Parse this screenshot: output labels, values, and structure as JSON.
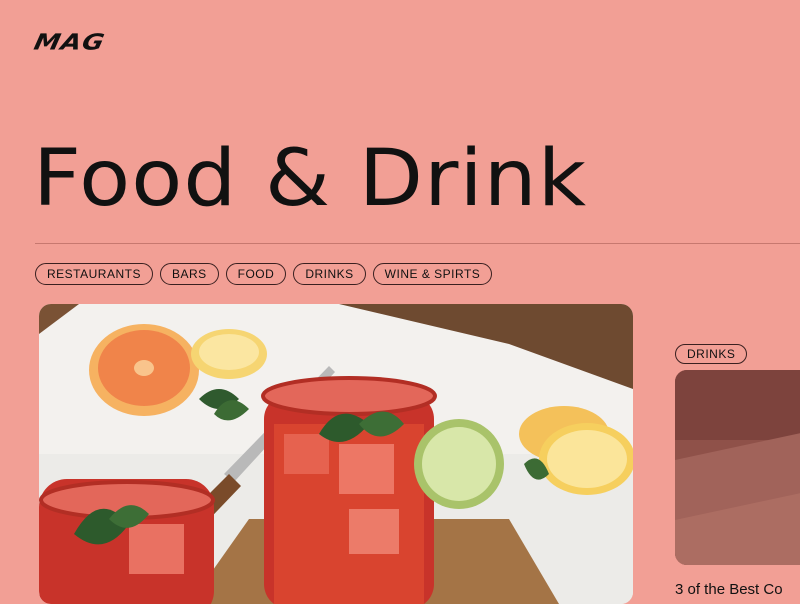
{
  "header": {
    "logo": "MAG"
  },
  "page": {
    "title": "Food & Drink"
  },
  "filters": [
    "RESTAURANTS",
    "BARS",
    "FOOD",
    "DRINKS",
    "WINE & SPIRTS"
  ],
  "side_article": {
    "tag": "DRINKS",
    "title": "3 of the Best Co"
  },
  "colors": {
    "background": "#f29f95",
    "text": "#111111",
    "divider": "#c7786f"
  }
}
